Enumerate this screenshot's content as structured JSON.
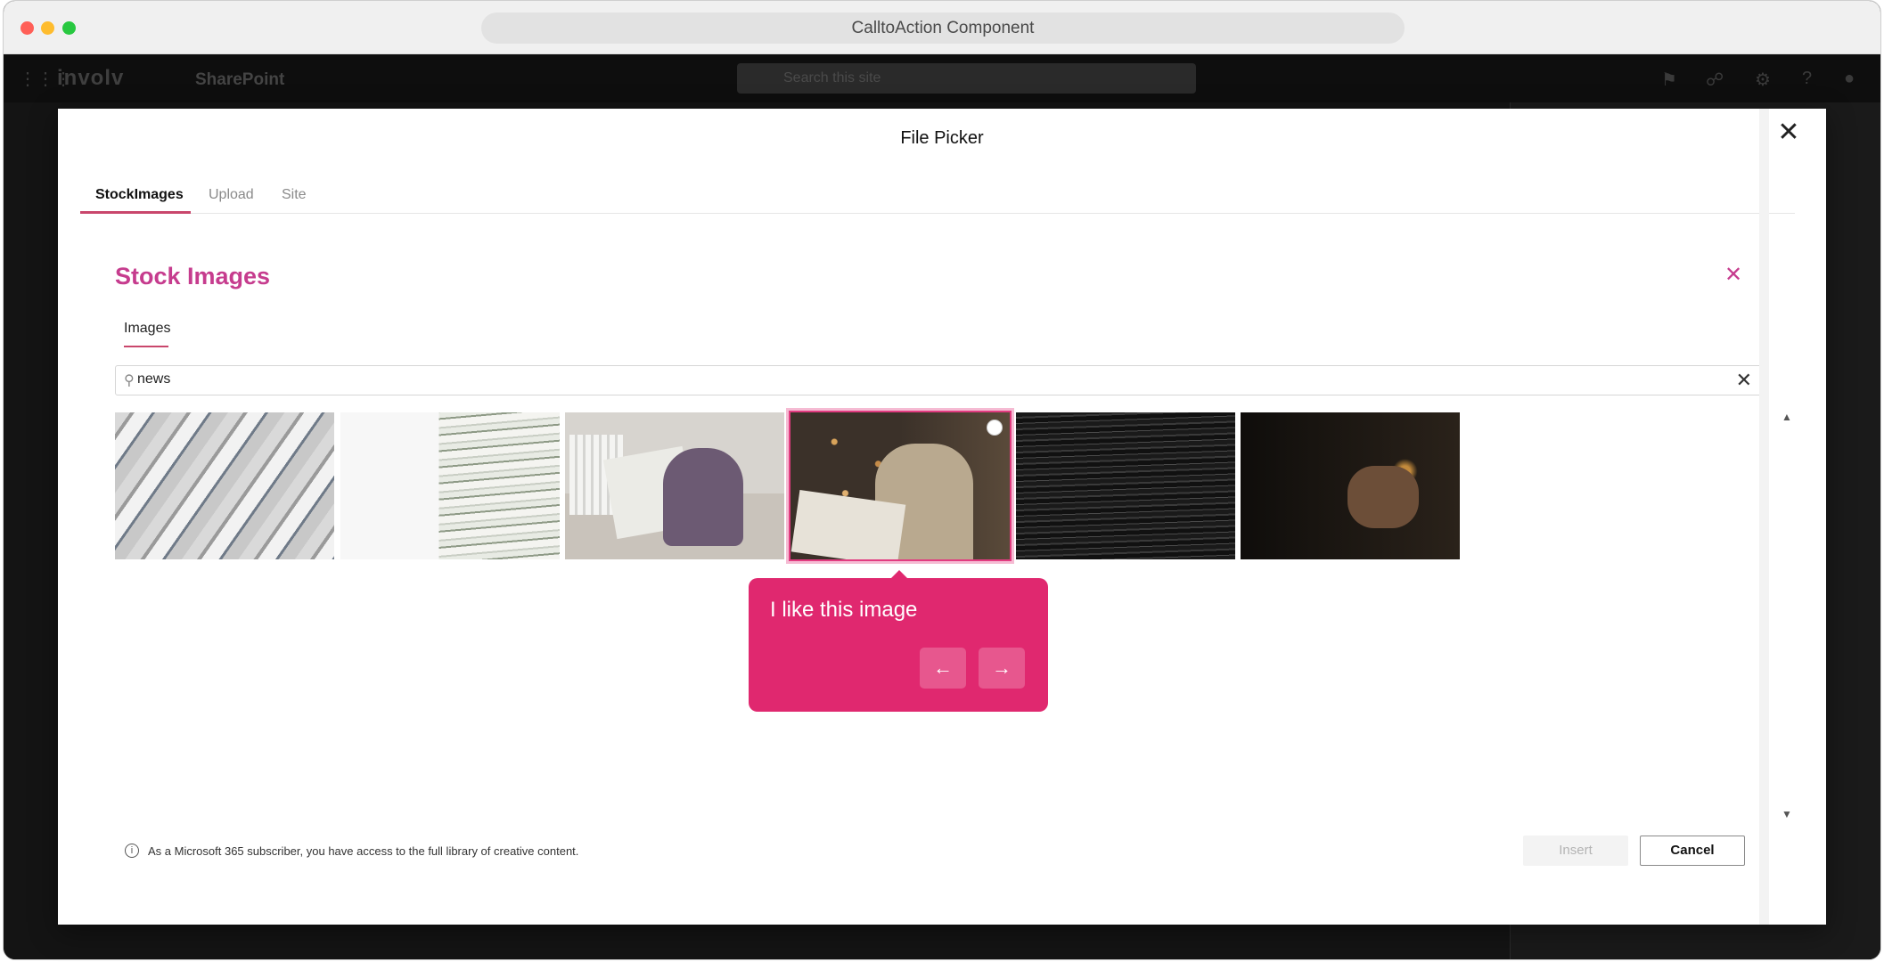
{
  "browser": {
    "url_title": "CalltoAction Component"
  },
  "suite_bar": {
    "brand": "involv",
    "app_name": "SharePoint",
    "search_placeholder": "Search this site"
  },
  "file_picker": {
    "title": "File Picker",
    "tabs": [
      {
        "label": "StockImages",
        "active": true
      },
      {
        "label": "Upload",
        "active": false
      },
      {
        "label": "Site",
        "active": false
      }
    ],
    "stock_images": {
      "title": "Stock Images",
      "subtab": "Images",
      "search_value": "news",
      "thumbnails": [
        {
          "subject": "newspapers"
        },
        {
          "subject": "newspaper stack"
        },
        {
          "subject": "man reading newspaper"
        },
        {
          "subject": "businessman reading newspaper",
          "selected": true
        },
        {
          "subject": "dark wood texture"
        },
        {
          "subject": "person with phone"
        }
      ]
    },
    "callout": {
      "text": "I like this image"
    },
    "footer": {
      "info": "As a Microsoft 365 subscriber, you have access to the full library of creative content.",
      "insert_label": "Insert",
      "cancel_label": "Cancel"
    }
  },
  "colors": {
    "accent": "#e0286f",
    "stock_title": "#c63c8e",
    "tab_underline": "#c9466c"
  }
}
